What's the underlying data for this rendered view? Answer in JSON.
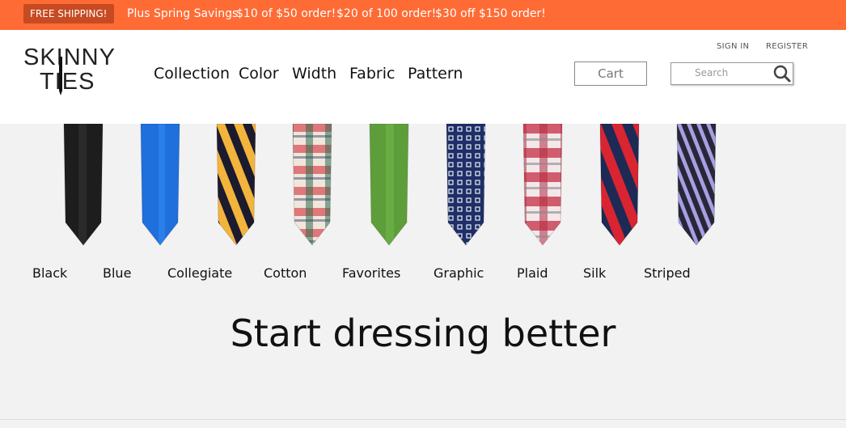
{
  "promo": {
    "badge": "FREE SHIPPING!",
    "items": [
      "Plus Spring Savings",
      "$10 of $50 order!",
      "$20 of 100 order!",
      "$30 off $150 order!"
    ]
  },
  "logo": {
    "line1": "SKINNY",
    "line2": "TIES"
  },
  "nav": [
    "Collection",
    "Color",
    "Width",
    "Fabric",
    "Pattern"
  ],
  "account": {
    "signin": "SIGN IN",
    "register": "REGISTER"
  },
  "cart": {
    "label": "Cart"
  },
  "search": {
    "placeholder": "Search"
  },
  "categories": [
    {
      "label": "Black",
      "pattern": "black"
    },
    {
      "label": "Blue",
      "pattern": "blue"
    },
    {
      "label": "Collegiate",
      "pattern": "collegiate"
    },
    {
      "label": "Cotton",
      "pattern": "cotton"
    },
    {
      "label": "Favorites",
      "pattern": "favorites"
    },
    {
      "label": "Graphic",
      "pattern": "graphic"
    },
    {
      "label": "Plaid",
      "pattern": "plaid"
    },
    {
      "label": "Silk",
      "pattern": "silk"
    },
    {
      "label": "Striped",
      "pattern": "striped"
    }
  ],
  "headline": "Start dressing better",
  "colors": {
    "promo_bg": "#ff6b35",
    "promo_badge": "#c74a22"
  }
}
